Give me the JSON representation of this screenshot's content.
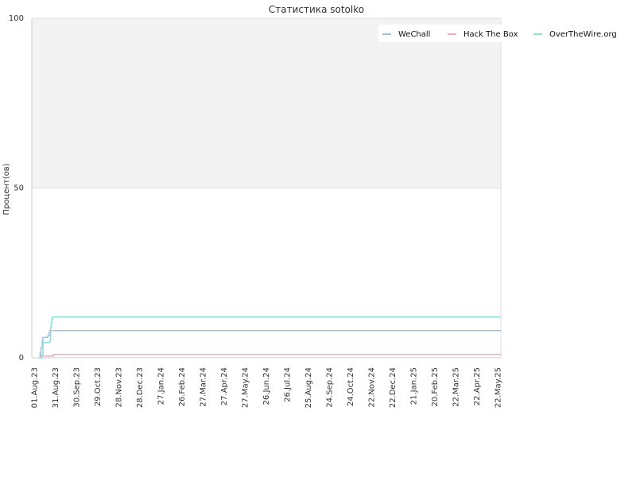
{
  "chart_data": {
    "type": "line",
    "title": "Статистика sotolko",
    "xlabel": "",
    "ylabel": "Процент(ов)",
    "ylim": [
      0,
      100
    ],
    "y_ticks": [
      "0",
      "50",
      "100"
    ],
    "x_ticks": [
      "01.Aug.23",
      "31.Aug.23",
      "30.Sep.23",
      "29.Oct.23",
      "28.Nov.23",
      "28.Dec.23",
      "27.Jan.24",
      "26.Feb.24",
      "27.Mar.24",
      "27.Apr.24",
      "27.May.24",
      "26.Jun.24",
      "26.Jul.24",
      "25.Aug.24",
      "24.Sep.24",
      "24.Oct.24",
      "22.Nov.24",
      "22.Dec.24",
      "21.Jan.25",
      "20.Feb.25",
      "22.Mar.25",
      "22.Apr.25",
      "22.May.25"
    ],
    "xlim": [
      "2023-08-01",
      "2025-06-05"
    ],
    "upper_band": {
      "from": 50,
      "to": 100,
      "color": "#f3f3f3"
    },
    "grid": true,
    "legend_position": "top-right",
    "series": [
      {
        "name": "WeChall",
        "color": "#9ac2e6",
        "points": [
          [
            "2023-08-12",
            0
          ],
          [
            "2023-08-13",
            1.5
          ],
          [
            "2023-08-14",
            3
          ],
          [
            "2023-08-16",
            5
          ],
          [
            "2023-08-17",
            6
          ],
          [
            "2023-08-24",
            6.5
          ],
          [
            "2023-08-26",
            7.5
          ],
          [
            "2023-08-27",
            8
          ],
          [
            "2025-06-05",
            8
          ]
        ]
      },
      {
        "name": "Hack The Box",
        "color": "#f0a8c8",
        "points": [
          [
            "2023-08-12",
            0
          ],
          [
            "2023-08-13",
            0.5
          ],
          [
            "2023-09-01",
            1
          ],
          [
            "2025-06-05",
            1
          ]
        ]
      },
      {
        "name": "OverTheWire.org",
        "color": "#88e0d0",
        "points": [
          [
            "2023-08-12",
            0
          ],
          [
            "2023-08-15",
            1
          ],
          [
            "2023-08-17",
            4.5
          ],
          [
            "2023-08-27",
            5
          ],
          [
            "2023-08-28",
            9
          ],
          [
            "2023-08-29",
            10.5
          ],
          [
            "2023-08-30",
            11.5
          ],
          [
            "2023-08-31",
            12
          ],
          [
            "2025-06-05",
            12
          ]
        ]
      }
    ]
  }
}
